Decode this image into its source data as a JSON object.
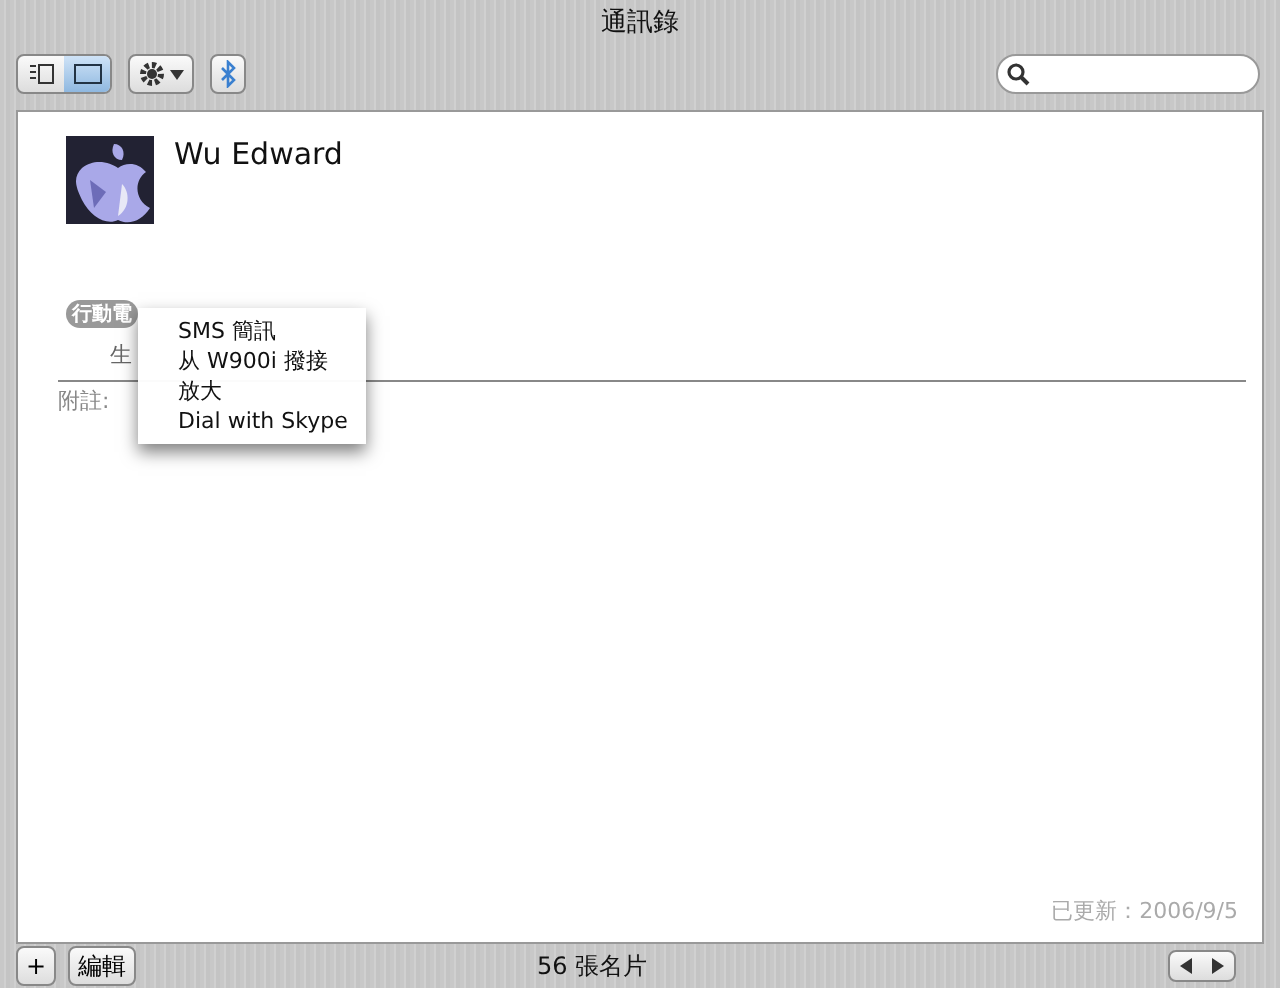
{
  "window": {
    "title": "通訊錄"
  },
  "toolbar": {
    "view_buttons": [
      {
        "kind": "columns",
        "selected": false
      },
      {
        "kind": "card",
        "selected": true
      }
    ]
  },
  "card": {
    "name": "Wu Edward",
    "phone_label": "行動電",
    "field_label": "生",
    "note_label": "附註:",
    "updated": "已更新：2006/9/5"
  },
  "context_menu": [
    "SMS 簡訊",
    "从 W900i 撥接",
    "放大",
    "Dial with Skype"
  ],
  "status_bar": {
    "add": "+",
    "edit": "編輯",
    "count": "56 張名片"
  }
}
